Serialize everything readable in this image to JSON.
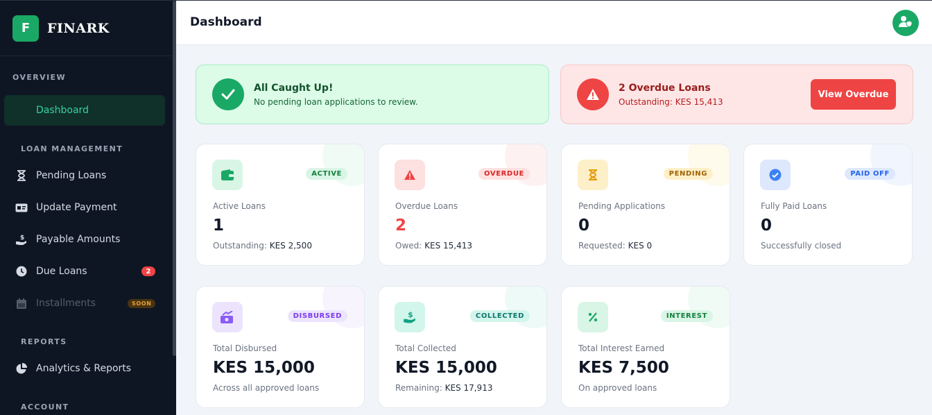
{
  "brand": {
    "logo_letter": "F",
    "name": "FINARK"
  },
  "sidebar": {
    "overview_label": "OVERVIEW",
    "dashboard": "Dashboard",
    "loan_management_label": "LOAN MANAGEMENT",
    "pending_loans": "Pending Loans",
    "update_payment": "Update Payment",
    "payable_amounts": "Payable Amounts",
    "due_loans": "Due Loans",
    "due_loans_badge": "2",
    "installments": "Installments",
    "installments_badge": "SOON",
    "reports_label": "REPORTS",
    "analytics": "Analytics & Reports",
    "account_label": "ACCOUNT"
  },
  "header": {
    "title": "Dashboard"
  },
  "banners": {
    "ok": {
      "title": "All Caught Up!",
      "text": "No pending loan applications to review."
    },
    "bad": {
      "title": "2 Overdue Loans",
      "text": "Outstanding: KES 15,413",
      "button": "View Overdue"
    }
  },
  "cards": {
    "active": {
      "pill": "ACTIVE",
      "label": "Active Loans",
      "value": "1",
      "sub_prefix": "Outstanding:",
      "sub_value": "KES 2,500"
    },
    "overdue": {
      "pill": "OVERDUE",
      "label": "Overdue Loans",
      "value": "2",
      "sub_prefix": "Owed:",
      "sub_value": "KES 15,413"
    },
    "pending": {
      "pill": "PENDING",
      "label": "Pending Applications",
      "value": "0",
      "sub_prefix": "Requested:",
      "sub_value": "KES 0"
    },
    "paid": {
      "pill": "PAID OFF",
      "label": "Fully Paid Loans",
      "value": "0",
      "sub": "Successfully closed"
    },
    "disbursed": {
      "pill": "DISBURSED",
      "label": "Total Disbursed",
      "value": "KES 15,000",
      "sub": "Across all approved loans"
    },
    "collected": {
      "pill": "COLLECTED",
      "label": "Total Collected",
      "value": "KES 15,000",
      "sub_prefix": "Remaining:",
      "sub_value": "KES 17,913"
    },
    "interest": {
      "pill": "INTEREST",
      "label": "Total Interest Earned",
      "value": "KES 7,500",
      "sub": "On approved loans"
    }
  },
  "colors": {
    "accent": "#1aa866",
    "danger": "#ef4444",
    "sidebar_bg": "#0f1623"
  }
}
